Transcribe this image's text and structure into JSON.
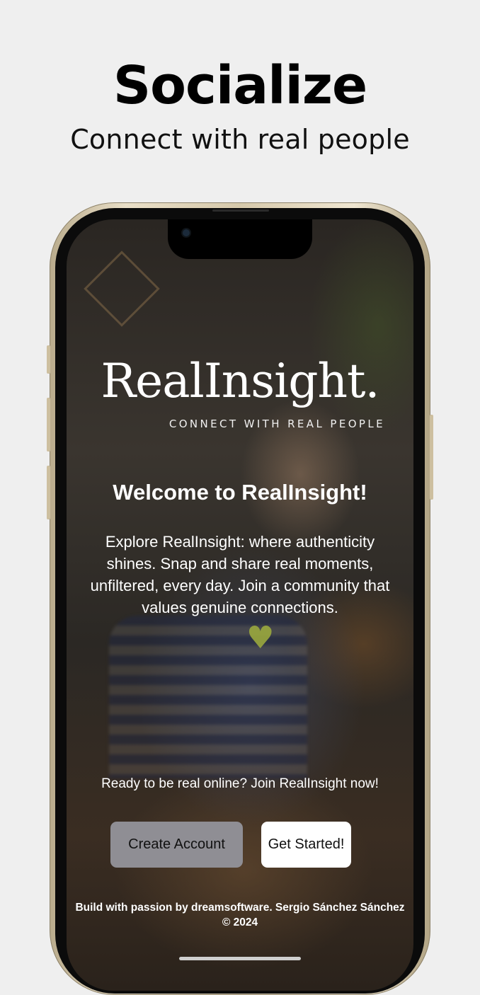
{
  "header": {
    "title": "Socialize",
    "subtitle": "Connect with real people"
  },
  "app": {
    "logo": "RealInsight.",
    "tagline": "CONNECT WITH REAL PEOPLE",
    "welcome_title": "Welcome to RealInsight!",
    "intro_text": "Explore RealInsight: where authenticity shines. Snap and share real moments, unfiltered, every day. Join a community that values genuine connections.",
    "cta_text": "Ready to be real online? Join RealInsight now!",
    "buttons": {
      "create_account": "Create Account",
      "get_started": "Get Started!"
    },
    "footer": "Build with passion by dreamsoftware. Sergio Sánchez Sánchez © 2024"
  },
  "colors": {
    "page_background": "#efefef",
    "create_button": "#8f8e94",
    "get_started_button": "#ffffff",
    "phone_frame": "#e9dfc8"
  }
}
